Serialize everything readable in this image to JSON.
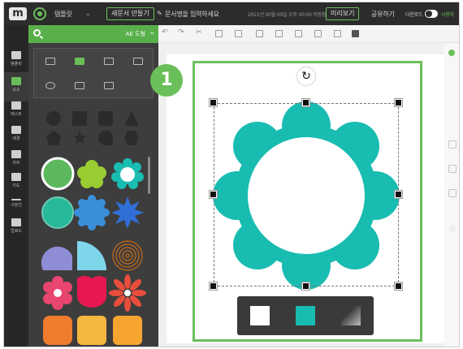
{
  "topbar": {
    "logo": "m",
    "menu1": "템플릿",
    "btn_new": "새문서 만들기",
    "doc_title": "문서명을 입력하세요",
    "save_status": "2021년 00월 00일 오후 00:00 저장됨",
    "btn_preview": "미리보기",
    "share": "공유하기",
    "download": "다운로드",
    "user": "사용자"
  },
  "rail": {
    "items": [
      "템플릿",
      "요소",
      "텍스트",
      "배경",
      "차트",
      "지도",
      "구분선",
      "업로드"
    ]
  },
  "search": {
    "selected": "AE 도형",
    "chevron": "⌄"
  },
  "callout": "1",
  "rotate_symbol": "↻",
  "colors": {
    "accent": "#6bbf5a",
    "flower": "#18bcb1",
    "panel_bg": "#3d3d3d"
  },
  "swatches": [
    "white",
    "teal",
    "gradient"
  ]
}
